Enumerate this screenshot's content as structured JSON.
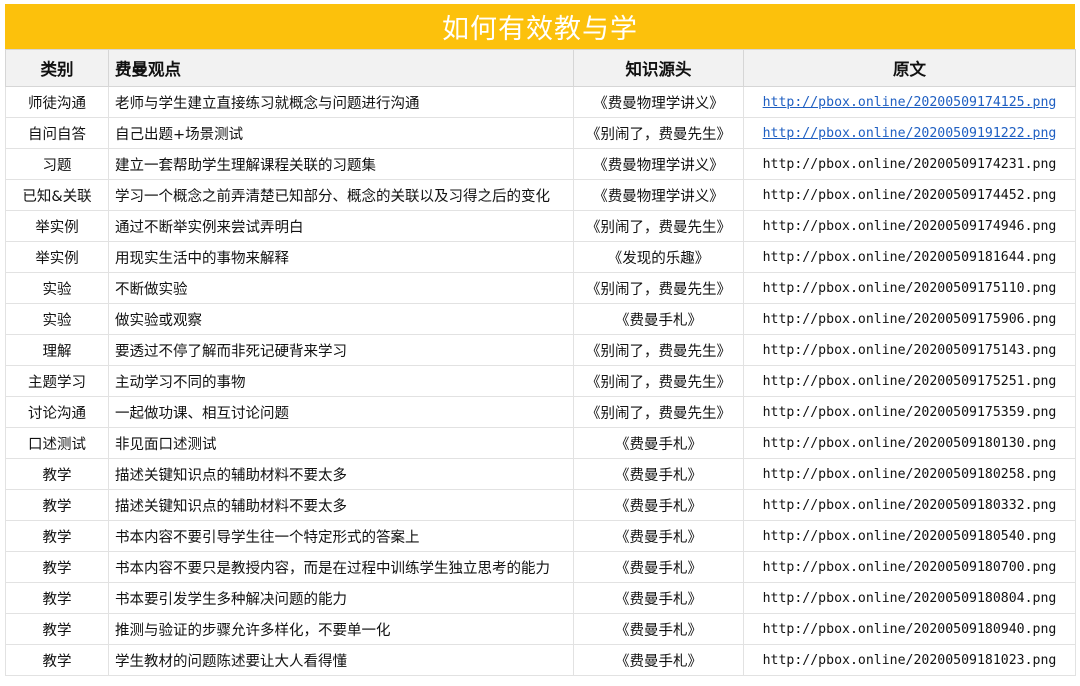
{
  "title": "如何有效教与学",
  "headers": {
    "category": "类别",
    "view": "费曼观点",
    "source": "知识源头",
    "original": "原文"
  },
  "rows": [
    {
      "category": "师徒沟通",
      "view": "老师与学生建立直接练习就概念与问题进行沟通",
      "source": "《费曼物理学讲义》",
      "url": "http://pbox.online/20200509174125.png",
      "link": true
    },
    {
      "category": "自问自答",
      "view": "自己出题+场景测试",
      "source": "《别闹了，费曼先生》",
      "url": "http://pbox.online/20200509191222.png",
      "link": true
    },
    {
      "category": "习题",
      "view": "建立一套帮助学生理解课程关联的习题集",
      "source": "《费曼物理学讲义》",
      "url": "http://pbox.online/20200509174231.png",
      "link": false
    },
    {
      "category": "已知&关联",
      "view": "学习一个概念之前弄清楚已知部分、概念的关联以及习得之后的变化",
      "source": "《费曼物理学讲义》",
      "url": "http://pbox.online/20200509174452.png",
      "link": false
    },
    {
      "category": "举实例",
      "view": "通过不断举实例来尝试弄明白",
      "source": "《别闹了，费曼先生》",
      "url": "http://pbox.online/20200509174946.png",
      "link": false
    },
    {
      "category": "举实例",
      "view": "用现实生活中的事物来解释",
      "source": "《发现的乐趣》",
      "url": "http://pbox.online/20200509181644.png",
      "link": false
    },
    {
      "category": "实验",
      "view": "不断做实验",
      "source": "《别闹了，费曼先生》",
      "url": "http://pbox.online/20200509175110.png",
      "link": false
    },
    {
      "category": "实验",
      "view": "做实验或观察",
      "source": "《费曼手札》",
      "url": "http://pbox.online/20200509175906.png",
      "link": false
    },
    {
      "category": "理解",
      "view": "要透过不停了解而非死记硬背来学习",
      "source": "《别闹了，费曼先生》",
      "url": "http://pbox.online/20200509175143.png",
      "link": false
    },
    {
      "category": "主题学习",
      "view": "主动学习不同的事物",
      "source": "《别闹了，费曼先生》",
      "url": "http://pbox.online/20200509175251.png",
      "link": false
    },
    {
      "category": "讨论沟通",
      "view": "一起做功课、相互讨论问题",
      "source": "《别闹了，费曼先生》",
      "url": "http://pbox.online/20200509175359.png",
      "link": false
    },
    {
      "category": "口述测试",
      "view": "非见面口述测试",
      "source": "《费曼手札》",
      "url": "http://pbox.online/20200509180130.png",
      "link": false
    },
    {
      "category": "教学",
      "view": "描述关键知识点的辅助材料不要太多",
      "source": "《费曼手札》",
      "url": "http://pbox.online/20200509180258.png",
      "link": false
    },
    {
      "category": "教学",
      "view": "描述关键知识点的辅助材料不要太多",
      "source": "《费曼手札》",
      "url": "http://pbox.online/20200509180332.png",
      "link": false
    },
    {
      "category": "教学",
      "view": "书本内容不要引导学生往一个特定形式的答案上",
      "source": "《费曼手札》",
      "url": "http://pbox.online/20200509180540.png",
      "link": false
    },
    {
      "category": "教学",
      "view": "书本内容不要只是教授内容，而是在过程中训练学生独立思考的能力",
      "source": "《费曼手札》",
      "url": "http://pbox.online/20200509180700.png",
      "link": false
    },
    {
      "category": "教学",
      "view": "书本要引发学生多种解决问题的能力",
      "source": "《费曼手札》",
      "url": "http://pbox.online/20200509180804.png",
      "link": false
    },
    {
      "category": "教学",
      "view": "推测与验证的步骤允许多样化，不要单一化",
      "source": "《费曼手札》",
      "url": "http://pbox.online/20200509180940.png",
      "link": false
    },
    {
      "category": "教学",
      "view": "学生教材的问题陈述要让大人看得懂",
      "source": "《费曼手札》",
      "url": "http://pbox.online/20200509181023.png",
      "link": false
    }
  ],
  "colors": {
    "title_bg": "#fcc10c",
    "link": "#1f5fc2",
    "header_bg": "#f2f2f2"
  }
}
